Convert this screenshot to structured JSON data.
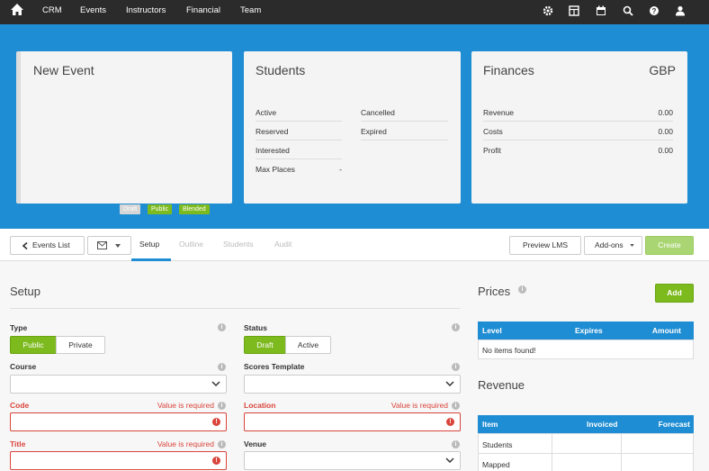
{
  "nav": {
    "links": [
      "CRM",
      "Events",
      "Instructors",
      "Financial",
      "Team"
    ],
    "right_icons": [
      "gear-icon",
      "grid-icon",
      "calendar-icon",
      "search-icon",
      "help-icon",
      "user-icon"
    ]
  },
  "event_card": {
    "title": "New Event",
    "badges": [
      "Draft",
      "Public",
      "Blended"
    ]
  },
  "students_card": {
    "title": "Students",
    "left_rows": [
      {
        "label": "Active",
        "value": ""
      },
      {
        "label": "Reserved",
        "value": ""
      },
      {
        "label": "Interested",
        "value": ""
      },
      {
        "label": "Max Places",
        "value": "-"
      }
    ],
    "right_rows": [
      {
        "label": "Cancelled",
        "value": ""
      },
      {
        "label": "Expired",
        "value": ""
      }
    ]
  },
  "finances_card": {
    "title": "Finances",
    "currency": "GBP",
    "rows": [
      {
        "label": "Revenue",
        "value": "0.00"
      },
      {
        "label": "Costs",
        "value": "0.00"
      },
      {
        "label": "Profit",
        "value": "0.00"
      }
    ]
  },
  "toolbar": {
    "events_list": "Events List",
    "tabs": [
      "Setup",
      "Outline",
      "Students",
      "Audit"
    ],
    "preview": "Preview LMS",
    "addons": "Add-ons",
    "create": "Create"
  },
  "setup": {
    "heading": "Setup",
    "type_label": "Type",
    "type_options": [
      "Public",
      "Private"
    ],
    "status_label": "Status",
    "status_options": [
      "Draft",
      "Active"
    ],
    "course_label": "Course",
    "scores_label": "Scores Template",
    "code_label": "Code",
    "location_label": "Location",
    "title_label": "Title",
    "venue_label": "Venue",
    "required_msg": "Value is required"
  },
  "prices": {
    "heading": "Prices",
    "add": "Add",
    "columns": [
      "Level",
      "Expires",
      "Amount"
    ],
    "empty": "No items found!"
  },
  "revenue": {
    "heading": "Revenue",
    "columns": [
      "Item",
      "Invoiced",
      "Forecast"
    ],
    "rows": [
      "Students",
      "Mapped"
    ]
  },
  "colors": {
    "nav_bg": "#2b2b2b",
    "hero_bg": "#1f8dd3",
    "green": "#7dba1e",
    "error": "#d9443b"
  }
}
